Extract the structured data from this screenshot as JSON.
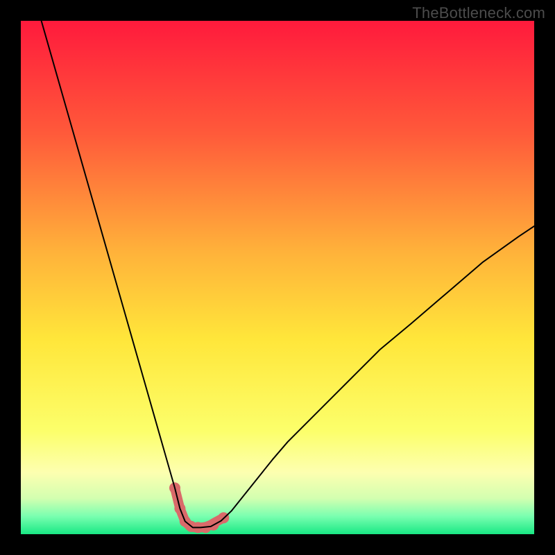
{
  "watermark": "TheBottleneck.com",
  "chart_data": {
    "type": "line",
    "title": "",
    "xlabel": "",
    "ylabel": "",
    "xlim": [
      0,
      100
    ],
    "ylim": [
      0,
      100
    ],
    "grid": false,
    "legend": false,
    "background_gradient_stops": [
      {
        "offset": 0.0,
        "color": "#ff1a3c"
      },
      {
        "offset": 0.22,
        "color": "#ff5a3a"
      },
      {
        "offset": 0.45,
        "color": "#ffb23a"
      },
      {
        "offset": 0.62,
        "color": "#ffe63a"
      },
      {
        "offset": 0.8,
        "color": "#fcff6b"
      },
      {
        "offset": 0.88,
        "color": "#fdffb0"
      },
      {
        "offset": 0.93,
        "color": "#d3ffb0"
      },
      {
        "offset": 0.965,
        "color": "#7affb0"
      },
      {
        "offset": 1.0,
        "color": "#18e884"
      }
    ],
    "series": [
      {
        "name": "bottleneck-curve",
        "color": "#000000",
        "stroke_width": 2,
        "x": [
          4,
          6,
          8,
          10,
          12,
          14,
          16,
          18,
          20,
          22,
          24,
          26,
          28,
          30,
          31,
          32,
          33.5,
          35,
          37,
          39,
          41,
          43,
          45,
          47,
          49,
          52,
          56,
          60,
          65,
          70,
          76,
          83,
          90,
          97,
          100
        ],
        "y": [
          100,
          93,
          86,
          79,
          72,
          65,
          58,
          51,
          44,
          37,
          30,
          23,
          16,
          9,
          5,
          2.5,
          1.3,
          1.3,
          1.5,
          2.6,
          4.5,
          7,
          9.5,
          12,
          14.5,
          18,
          22,
          26,
          31,
          36,
          41,
          47,
          53,
          58,
          60
        ]
      },
      {
        "name": "valley-highlight",
        "color": "#d96a6a",
        "stroke_width": 14,
        "linecap": "round",
        "x": [
          30,
          31,
          32,
          33,
          34,
          35,
          36,
          37,
          38,
          39.5
        ],
        "y": [
          9,
          5,
          2.5,
          1.5,
          1.3,
          1.3,
          1.4,
          1.8,
          2.4,
          3.2
        ]
      }
    ],
    "markers": {
      "name": "valley-dots",
      "color": "#d96a6a",
      "radius": 8,
      "x": [
        30,
        31,
        32,
        33.2,
        34.5,
        36,
        37.5,
        39.5
      ],
      "y": [
        9,
        5,
        2.5,
        1.5,
        1.3,
        1.3,
        1.8,
        3.2
      ]
    }
  }
}
